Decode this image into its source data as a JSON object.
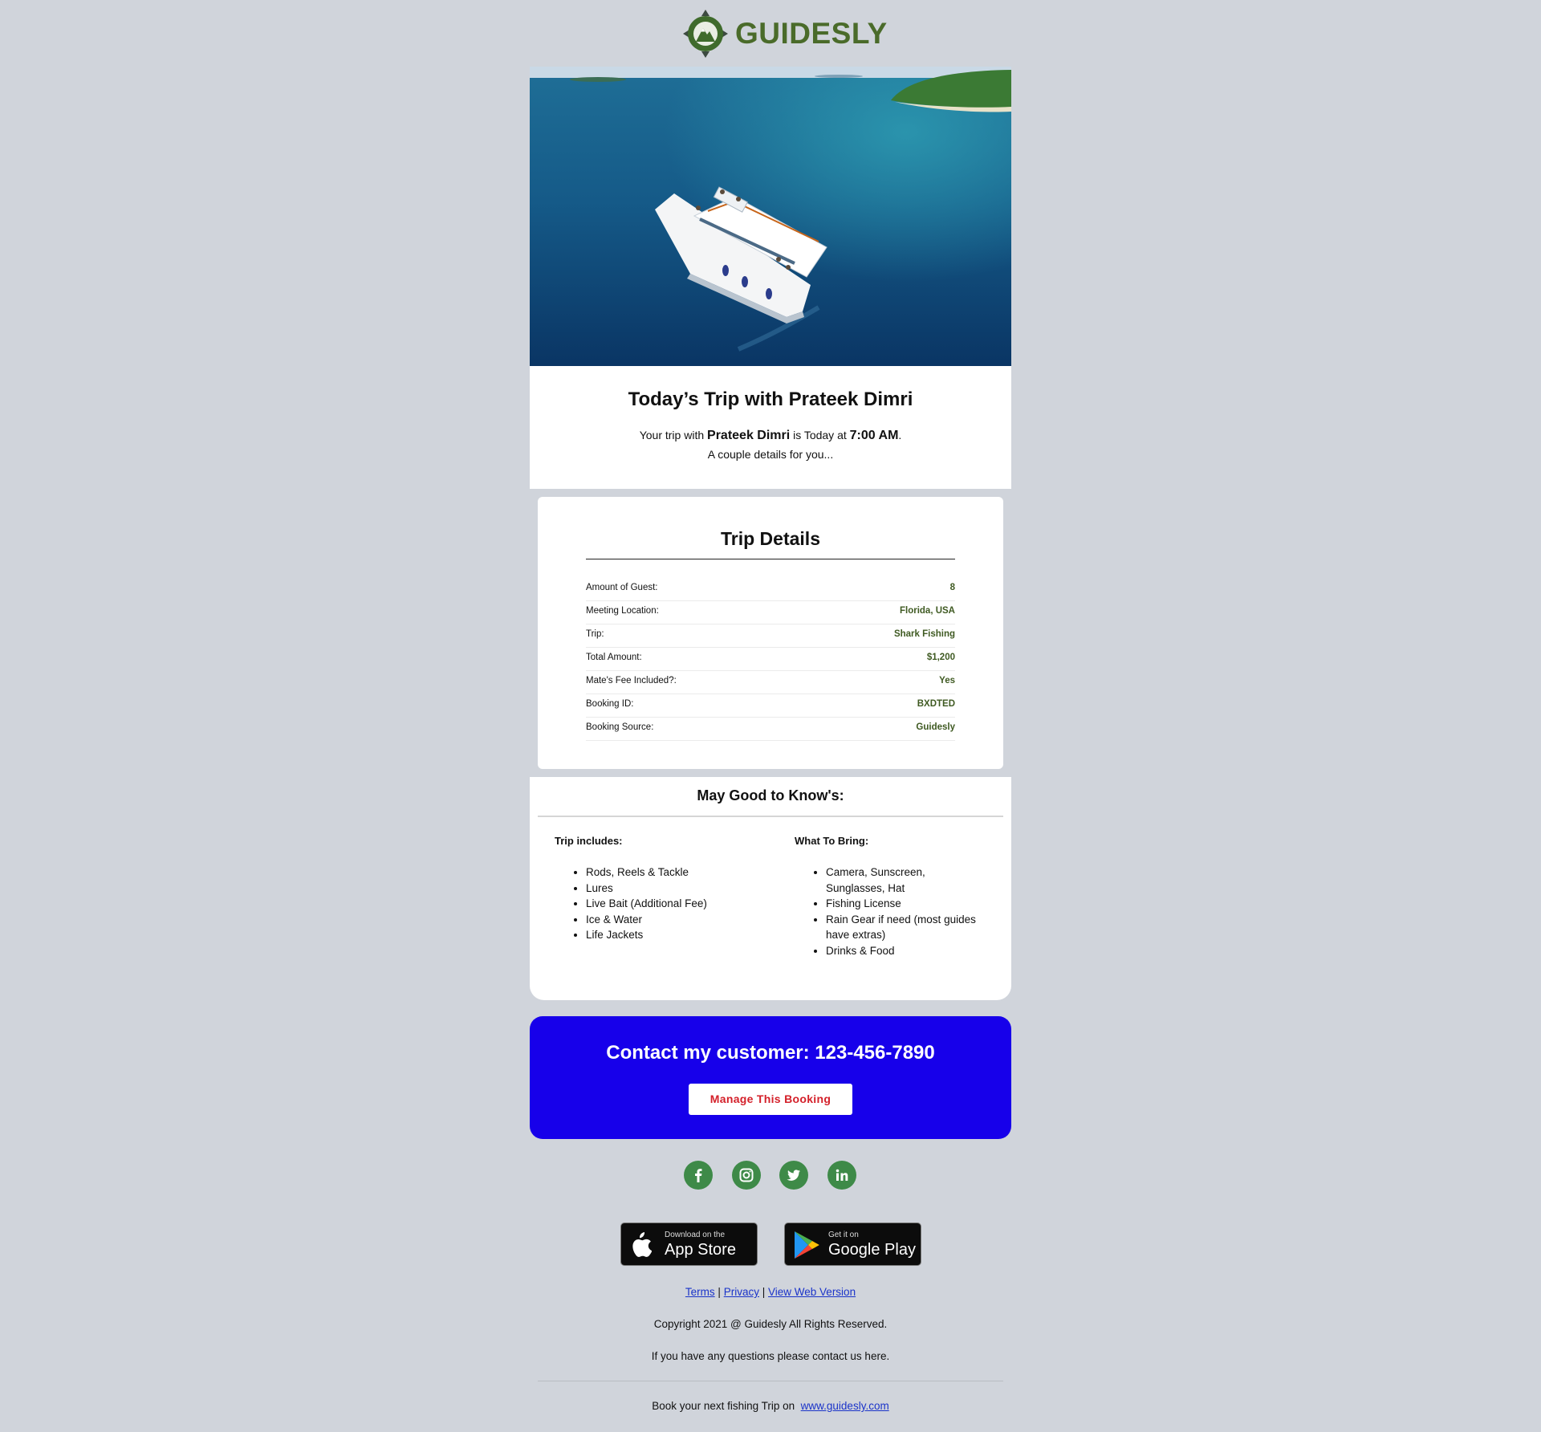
{
  "brand": {
    "name": "GUIDESLY"
  },
  "intro": {
    "title": "Today’s Trip with Prateek Dimri",
    "line_prefix": "Your trip with ",
    "guide_name": "Prateek Dimri",
    "line_middle": " is Today at ",
    "time": "7:00 AM",
    "line_suffix": ".",
    "subline": "A couple details for you..."
  },
  "details": {
    "title": "Trip Details",
    "rows": [
      {
        "label": "Amount of Guest:",
        "value": "8"
      },
      {
        "label": "Meeting Location:",
        "value": "Florida, USA"
      },
      {
        "label": "Trip:",
        "value": "Shark Fishing"
      },
      {
        "label": "Total Amount:",
        "value": "$1,200"
      },
      {
        "label": "Mate's Fee Included?:",
        "value": "Yes"
      },
      {
        "label": "Booking ID:",
        "value": "BXDTED"
      },
      {
        "label": "Booking Source:",
        "value": "Guidesly"
      }
    ]
  },
  "good_to_know": {
    "title": "May Good to Know's:",
    "includes": {
      "title": "Trip includes:",
      "items": [
        "Rods, Reels & Tackle",
        "Lures",
        "Live Bait (Additional Fee)",
        "Ice & Water",
        "Life Jackets"
      ]
    },
    "bring": {
      "title": "What To Bring:",
      "items": [
        "Camera, Sunscreen, Sunglasses, Hat",
        "Fishing License",
        "Rain Gear if need (most guides have extras)",
        "Drinks & Food"
      ]
    }
  },
  "contact": {
    "text": "Contact my customer: 123-456-7890",
    "button": "Manage This Booking"
  },
  "social": {
    "icons": [
      "facebook-icon",
      "instagram-icon",
      "twitter-icon",
      "linkedin-icon"
    ]
  },
  "stores": {
    "apple": {
      "small": "Download on the",
      "big": "App Store"
    },
    "google": {
      "small": "Get it on",
      "big": "Google Play"
    }
  },
  "footer": {
    "terms": "Terms",
    "privacy": "Privacy",
    "web_version": "View Web Version",
    "sep": "|",
    "copyright": "Copyright 2021 @ Guidesly All Rights Reserved.",
    "questions": "If you have any questions please contact us here.",
    "book_prefix": "Book your next fishing Trip on",
    "book_link": "www.guidesly.com"
  },
  "colors": {
    "page_bg": "#d0d4db",
    "brand_green": "#4a6b2a",
    "value_green": "#3f5a22",
    "contact_blue": "#1700ea",
    "button_red": "#d4202a",
    "link_blue": "#1a33c9"
  }
}
